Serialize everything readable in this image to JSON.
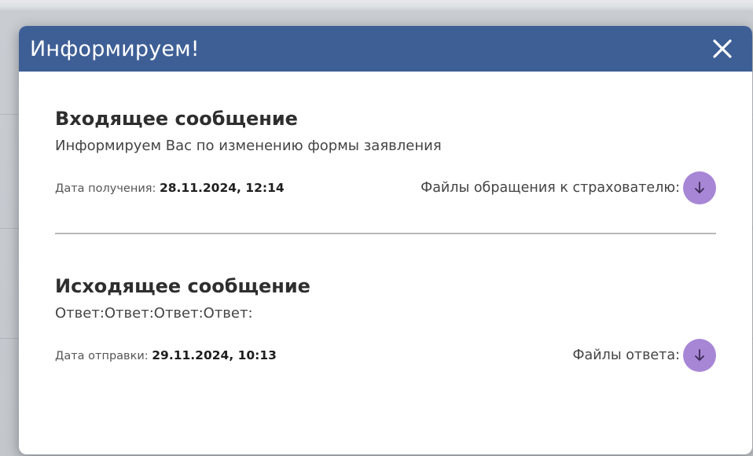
{
  "modal": {
    "title": "Информируем!",
    "close_icon": "close-icon"
  },
  "incoming": {
    "title": "Входящее сообщение",
    "text": "Информируем Вас по изменению формы заявления",
    "date_label": "Дата получения:",
    "date_value": "28.11.2024, 12:14",
    "files_label": "Файлы обращения к страхователю:",
    "download_icon": "download-arrow-icon"
  },
  "outgoing": {
    "title": "Исходящее сообщение",
    "text": "Ответ:Ответ:Ответ:Ответ:",
    "date_label": "Дата отправки:",
    "date_value": "29.11.2024, 10:13",
    "files_label": "Файлы ответа:",
    "download_icon": "download-arrow-icon"
  },
  "colors": {
    "header": "#3e5f96",
    "download_button": "#a886d6"
  }
}
